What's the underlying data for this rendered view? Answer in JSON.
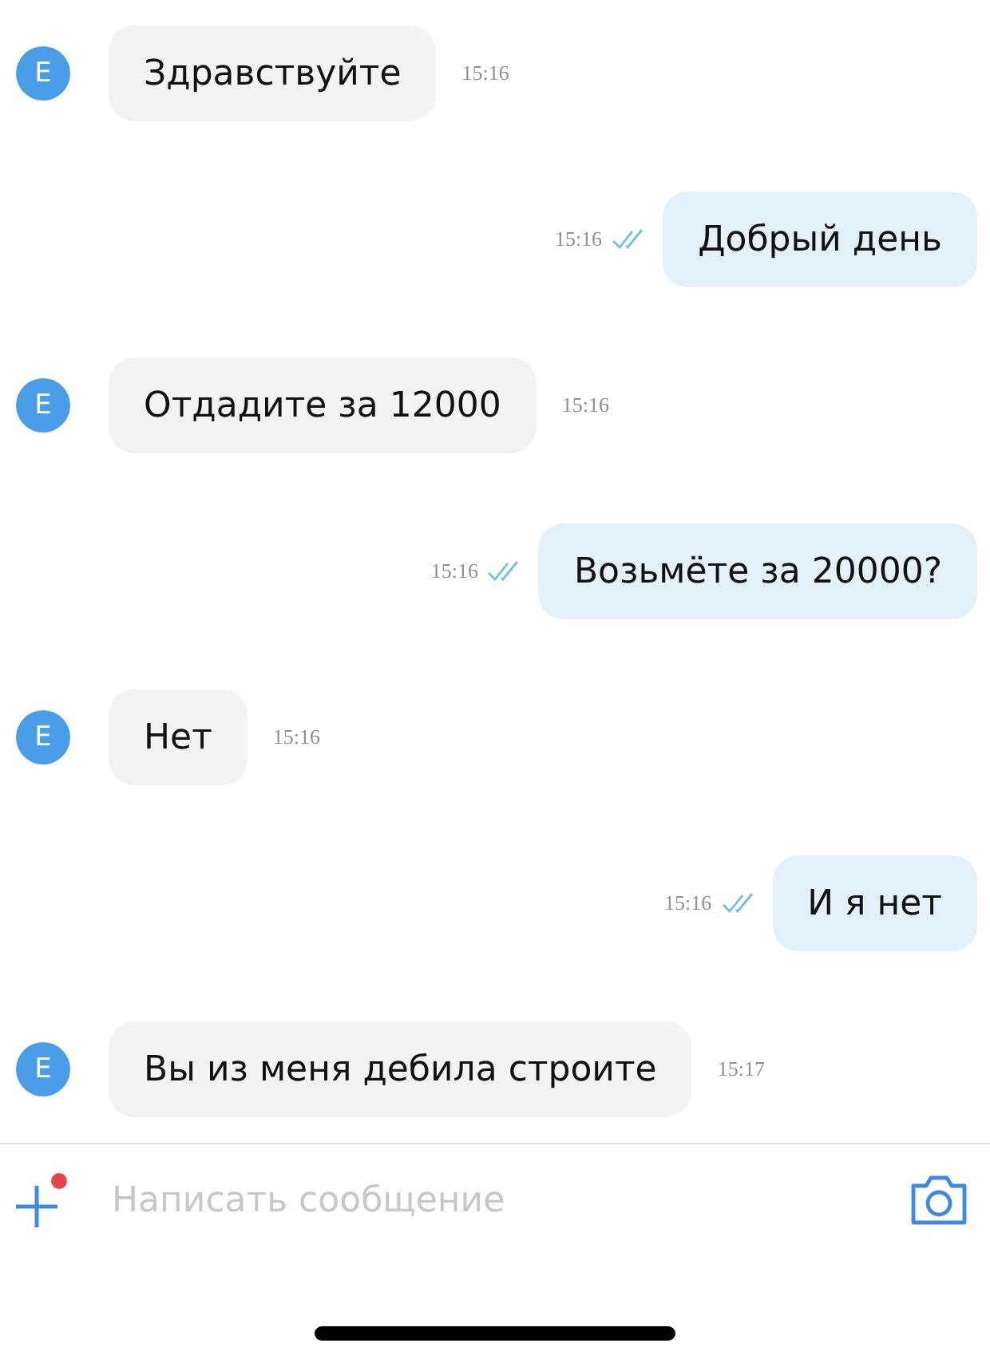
{
  "messages": [
    {
      "kind": "incoming",
      "avatar": "E",
      "text": "Здравствуйте",
      "time": "15:16"
    },
    {
      "kind": "outgoing",
      "text": "Добрый день",
      "time": "15:16",
      "read": true
    },
    {
      "kind": "incoming",
      "avatar": "E",
      "text": "Отдадите за 12000",
      "time": "15:16"
    },
    {
      "kind": "outgoing",
      "text": "Возьмёте за 20000?",
      "time": "15:16",
      "read": true
    },
    {
      "kind": "incoming",
      "avatar": "E",
      "text": "Нет",
      "time": "15:16"
    },
    {
      "kind": "outgoing",
      "text": "И я нет",
      "time": "15:16",
      "read": true
    },
    {
      "kind": "incoming",
      "avatar": "E",
      "text": "Вы из меня дебила строите",
      "time": "15:17"
    }
  ],
  "composer": {
    "placeholder": "Написать сообщение",
    "attachment_badge": true
  }
}
